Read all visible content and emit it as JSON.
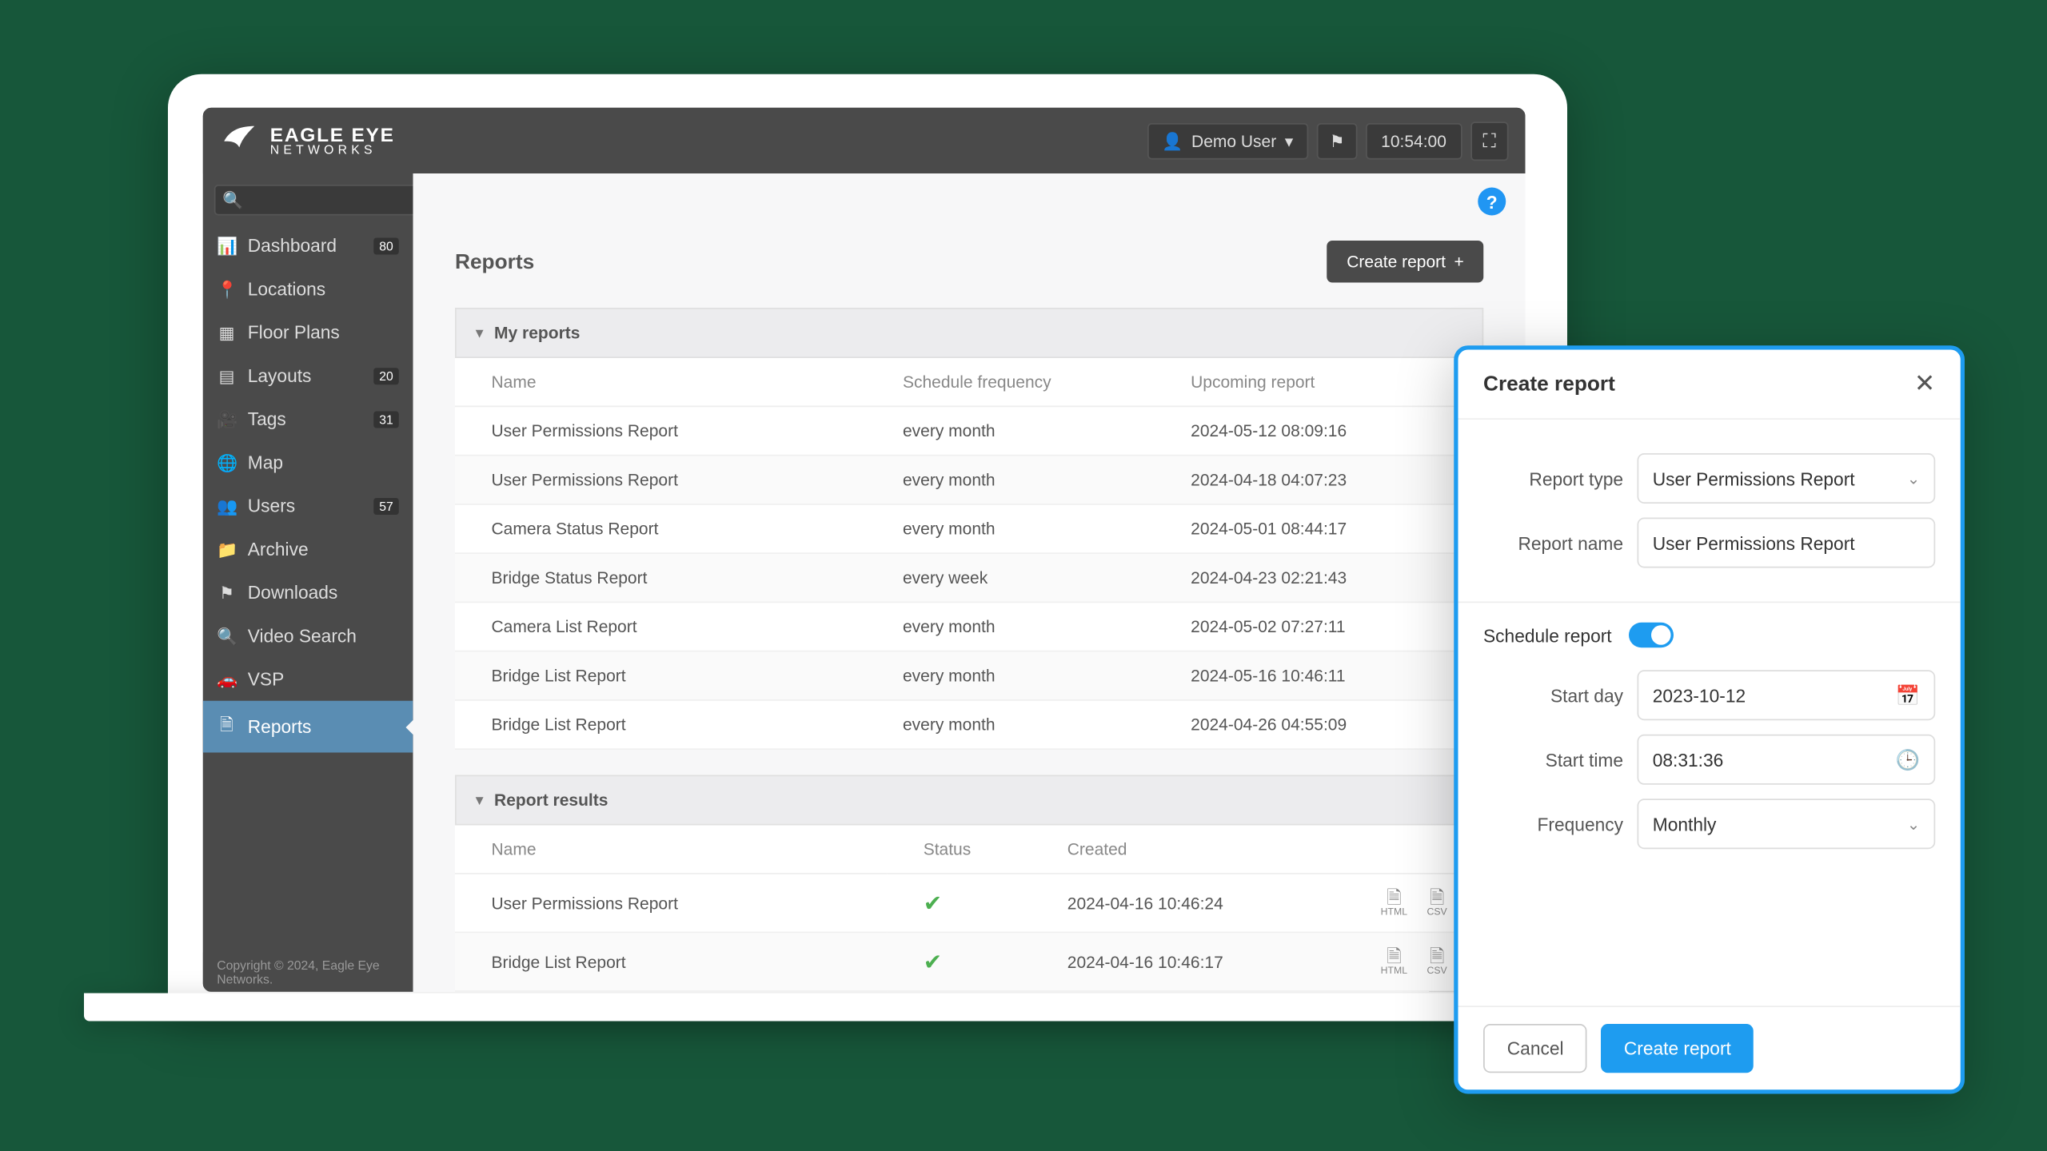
{
  "brand": {
    "line1": "EAGLE EYE",
    "line2": "NETWORKS"
  },
  "header": {
    "user_label": "Demo User",
    "time": "10:54:00"
  },
  "sidebar": {
    "items": [
      {
        "id": "dashboard",
        "label": "Dashboard",
        "icon": "⏱",
        "badge": "80"
      },
      {
        "id": "locations",
        "label": "Locations",
        "icon": "📍",
        "badge": null
      },
      {
        "id": "floorplans",
        "label": "Floor Plans",
        "icon": "▦",
        "badge": null
      },
      {
        "id": "layouts",
        "label": "Layouts",
        "icon": "▤",
        "badge": "20"
      },
      {
        "id": "tags",
        "label": "Tags",
        "icon": "🎥",
        "badge": "31"
      },
      {
        "id": "map",
        "label": "Map",
        "icon": "🌐",
        "badge": null
      },
      {
        "id": "users",
        "label": "Users",
        "icon": "👥",
        "badge": "57"
      },
      {
        "id": "archive",
        "label": "Archive",
        "icon": "📁",
        "badge": null
      },
      {
        "id": "downloads",
        "label": "Downloads",
        "icon": "⚑",
        "badge": null
      },
      {
        "id": "videosearch",
        "label": "Video Search",
        "icon": "🔍",
        "badge": null
      },
      {
        "id": "vsp",
        "label": "VSP",
        "icon": "🚗",
        "badge": null
      },
      {
        "id": "reports",
        "label": "Reports",
        "icon": "🗎",
        "badge": null,
        "active": true
      }
    ]
  },
  "page": {
    "title": "Reports",
    "create_button": "Create report",
    "my_reports_label": "My reports",
    "report_results_label": "Report results",
    "columns_my": {
      "name": "Name",
      "schedule": "Schedule frequency",
      "upcoming": "Upcoming report"
    },
    "columns_results": {
      "name": "Name",
      "status": "Status",
      "created": "Created"
    },
    "my_reports": [
      {
        "name": "User Permissions Report",
        "freq": "every month",
        "upcoming": "2024-05-12 08:09:16"
      },
      {
        "name": "User Permissions Report",
        "freq": "every month",
        "upcoming": "2024-04-18 04:07:23"
      },
      {
        "name": "Camera Status Report",
        "freq": "every month",
        "upcoming": "2024-05-01 08:44:17"
      },
      {
        "name": "Bridge Status Report",
        "freq": "every week",
        "upcoming": "2024-04-23 02:21:43"
      },
      {
        "name": "Camera List Report",
        "freq": "every month",
        "upcoming": "2024-05-02 07:27:11"
      },
      {
        "name": "Bridge List Report",
        "freq": "every month",
        "upcoming": "2024-05-16 10:46:11"
      },
      {
        "name": "Bridge List Report",
        "freq": "every month",
        "upcoming": "2024-04-26 04:55:09"
      }
    ],
    "results": [
      {
        "name": "User Permissions Report",
        "status": "ok",
        "created": "2024-04-16 10:46:24"
      },
      {
        "name": "Bridge List Report",
        "status": "ok",
        "created": "2024-04-16 10:46:17"
      }
    ],
    "download_labels": {
      "html": "HTML",
      "csv": "CSV"
    }
  },
  "modal": {
    "title": "Create report",
    "labels": {
      "report_type": "Report type",
      "report_name": "Report name",
      "schedule_report": "Schedule report",
      "start_day": "Start day",
      "start_time": "Start time",
      "frequency": "Frequency"
    },
    "values": {
      "report_type": "User Permissions Report",
      "report_name": "User Permissions Report",
      "start_day": "2023-10-12",
      "start_time": "08:31:36",
      "frequency": "Monthly"
    },
    "buttons": {
      "cancel": "Cancel",
      "create": "Create report"
    }
  },
  "footer": "Copyright © 2024, Eagle Eye Networks."
}
